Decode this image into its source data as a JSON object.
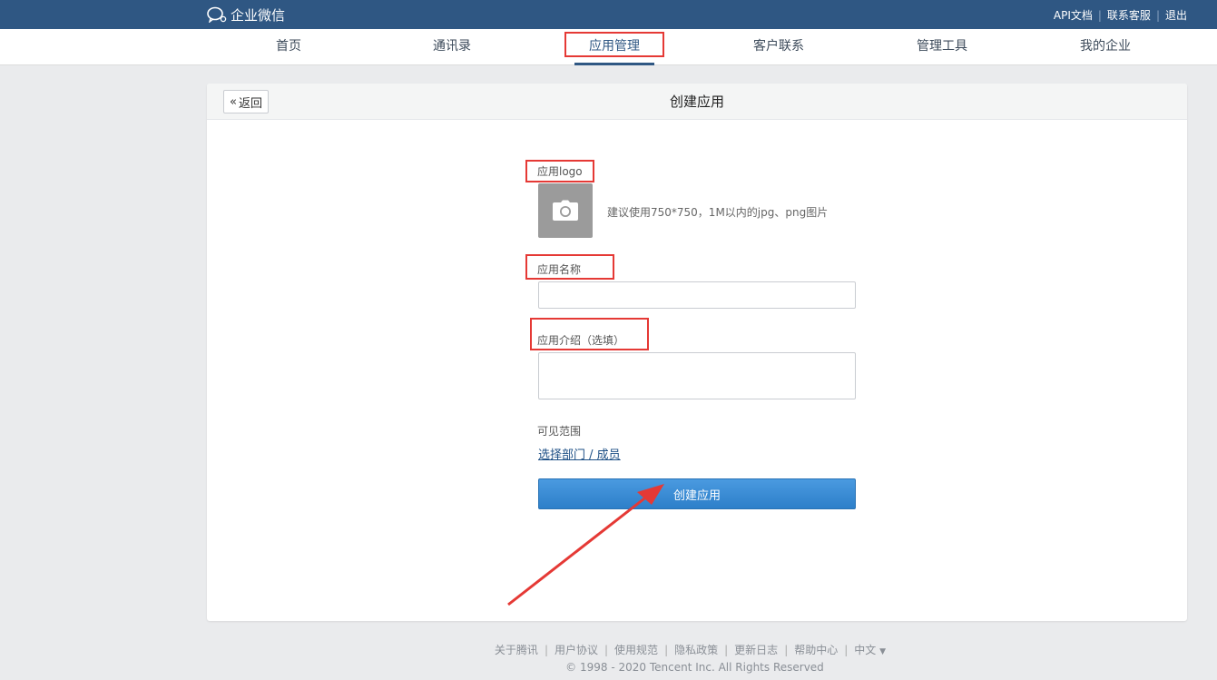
{
  "header": {
    "brand": "企业微信",
    "links": [
      "API文档",
      "联系客服",
      "退出"
    ]
  },
  "nav": {
    "items": [
      "首页",
      "通讯录",
      "应用管理",
      "客户联系",
      "管理工具",
      "我的企业"
    ],
    "active": "应用管理"
  },
  "card": {
    "back_label": "返回",
    "title": "创建应用"
  },
  "form": {
    "logo_label": "应用logo",
    "logo_hint": "建议使用750*750，1M以内的jpg、png图片",
    "name_label": "应用名称",
    "name_value": "",
    "desc_label": "应用介绍（选填）",
    "desc_value": "",
    "visibility_label": "可见范围",
    "visibility_link": "选择部门 / 成员",
    "submit_label": "创建应用"
  },
  "footer": {
    "links": [
      "关于腾讯",
      "用户协议",
      "使用规范",
      "隐私政策",
      "更新日志",
      "帮助中心",
      "中文"
    ],
    "copyright": "© 1998 - 2020 Tencent Inc. All Rights Reserved"
  },
  "colors": {
    "topbar": "#2f5783",
    "accent": "#2d7fc9",
    "annotation": "#e53935"
  }
}
